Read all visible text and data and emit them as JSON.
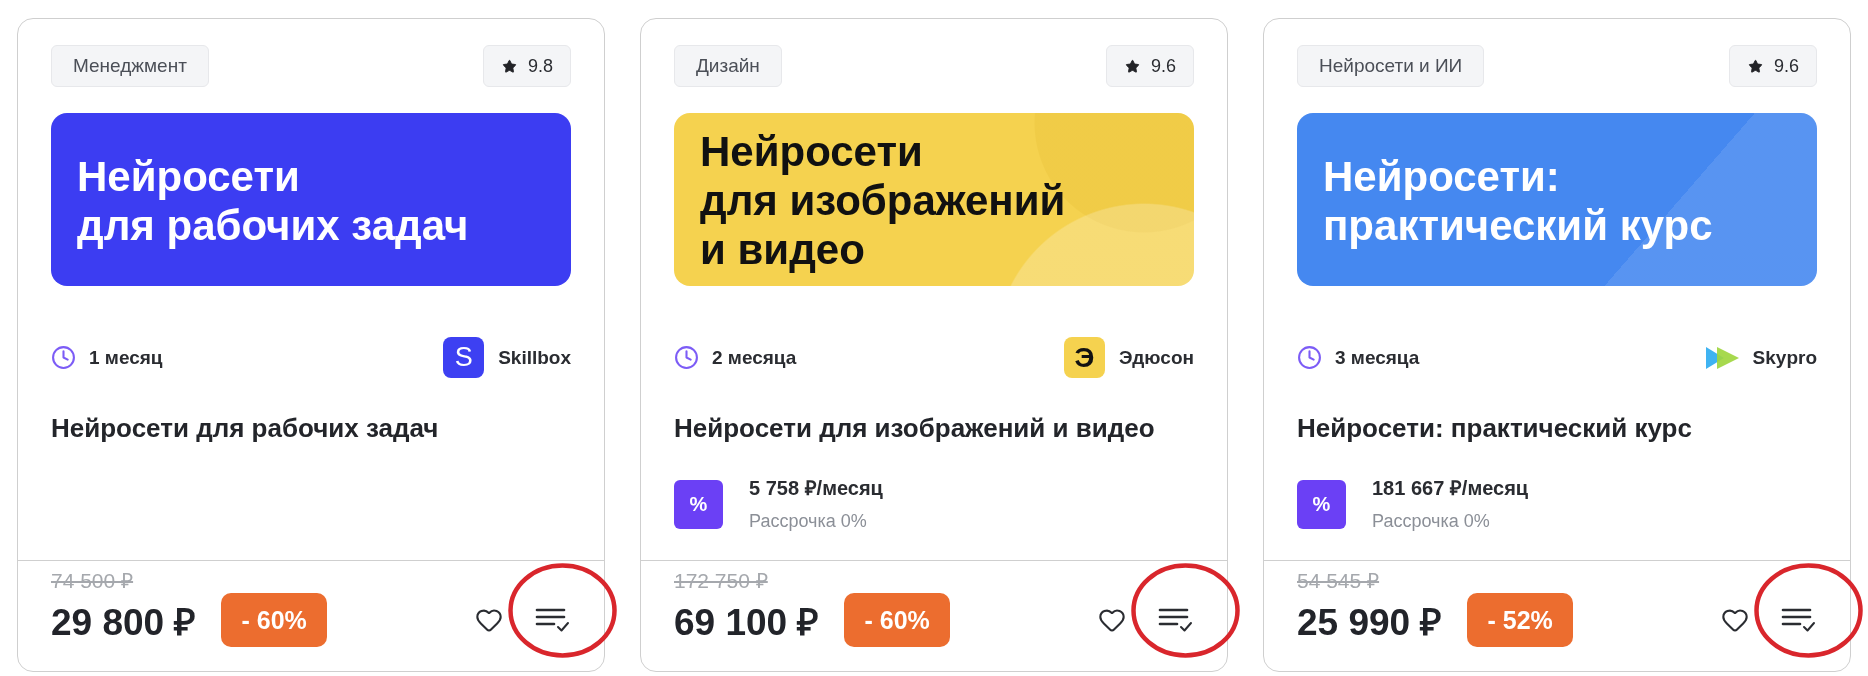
{
  "courses": [
    {
      "category": "Менеджмент",
      "rating": "9.8",
      "banner": {
        "kind": "plain",
        "color": "#3c3df2",
        "text": "Нейросети\nдля рабочих задач"
      },
      "duration": "1 месяц",
      "provider": {
        "name": "Skillbox",
        "logo": {
          "kind": "letter",
          "text": "S",
          "color": "#3d40f2"
        }
      },
      "title": "Нейросети для рабочих задач",
      "old_price": "74 500 ₽",
      "price": "29 800 ₽",
      "discount": "- 60%",
      "circled": true
    },
    {
      "category": "Дизайн",
      "rating": "9.6",
      "banner": {
        "kind": "circles",
        "color": "#f5d24f",
        "text": "Нейросети\nдля изображений\nи видео"
      },
      "duration": "2 месяца",
      "provider": {
        "name": "Эдюсон",
        "logo": {
          "kind": "letter",
          "text": "Э",
          "color": "#f5d24f"
        }
      },
      "title": "Нейросети для изображений и видео",
      "installment": {
        "badge": "%",
        "amount": "5 758 ₽/месяц",
        "note": "Рассрочка 0%"
      },
      "old_price": "172 750 ₽",
      "price": "69 100 ₽",
      "discount": "- 60%",
      "circled": true
    },
    {
      "category": "Нейросети и ИИ",
      "rating": "9.6",
      "banner": {
        "kind": "stripe",
        "color": "#4588f0",
        "text": "Нейросети:\nпрактический курс"
      },
      "duration": "3 месяца",
      "provider": {
        "name": "Skypro",
        "logo": {
          "kind": "arrows"
        }
      },
      "title": "Нейросети: практический курс",
      "installment": {
        "badge": "%",
        "amount": "181 667 ₽/месяц",
        "note": "Рассрочка 0%"
      },
      "old_price": "54 545 ₽",
      "price": "25 990 ₽",
      "discount": "- 52%",
      "circled": true
    }
  ]
}
